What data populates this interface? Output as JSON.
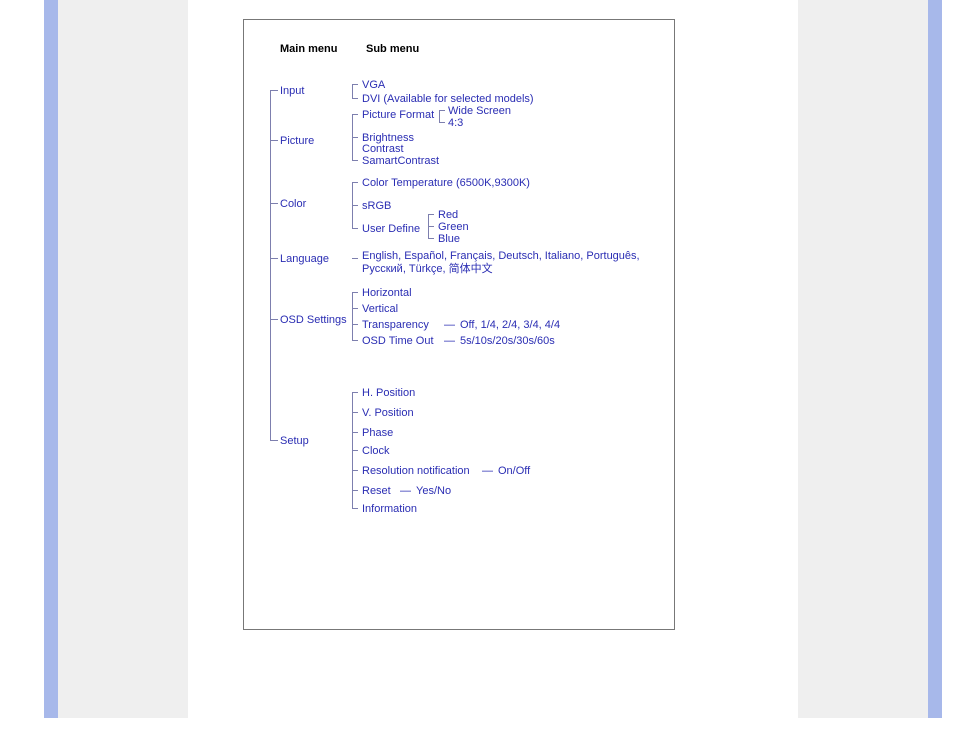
{
  "headers": {
    "main": "Main menu",
    "sub": "Sub menu"
  },
  "mainItems": {
    "input": "Input",
    "picture": "Picture",
    "color": "Color",
    "language": "Language",
    "osd": "OSD Settings",
    "setup": "Setup"
  },
  "input": {
    "vga": "VGA",
    "dvi": "DVI (Available for selected models)"
  },
  "picture": {
    "format": "Picture Format",
    "format_opts": {
      "wide": "Wide Screen",
      "ratio": "4:3"
    },
    "brightness": "Brightness",
    "contrast": "Contrast",
    "smart": "SamartContrast"
  },
  "color": {
    "temp": "Color Temperature (6500K,9300K)",
    "srgb": "sRGB",
    "user": "User Define",
    "rgb": {
      "r": "Red",
      "g": "Green",
      "b": "Blue"
    }
  },
  "language": {
    "line1": "English, Español, Français, Deutsch, Italiano, Português,",
    "line2": "Русский, Türkçe, 简体中文"
  },
  "osd": {
    "horizontal": "Horizontal",
    "vertical": "Vertical",
    "transparency": "Transparency",
    "transparency_vals": "Off, 1/4, 2/4, 3/4, 4/4",
    "timeout": "OSD Time Out",
    "timeout_vals": "5s/10s/20s/30s/60s"
  },
  "setup": {
    "hpos": "H. Position",
    "vpos": "V. Position",
    "phase": "Phase",
    "clock": "Clock",
    "resnotif": "Resolution notification",
    "resnotif_vals": "On/Off",
    "reset": "Reset",
    "reset_vals": "Yes/No",
    "info": "Information"
  },
  "dash": "—"
}
